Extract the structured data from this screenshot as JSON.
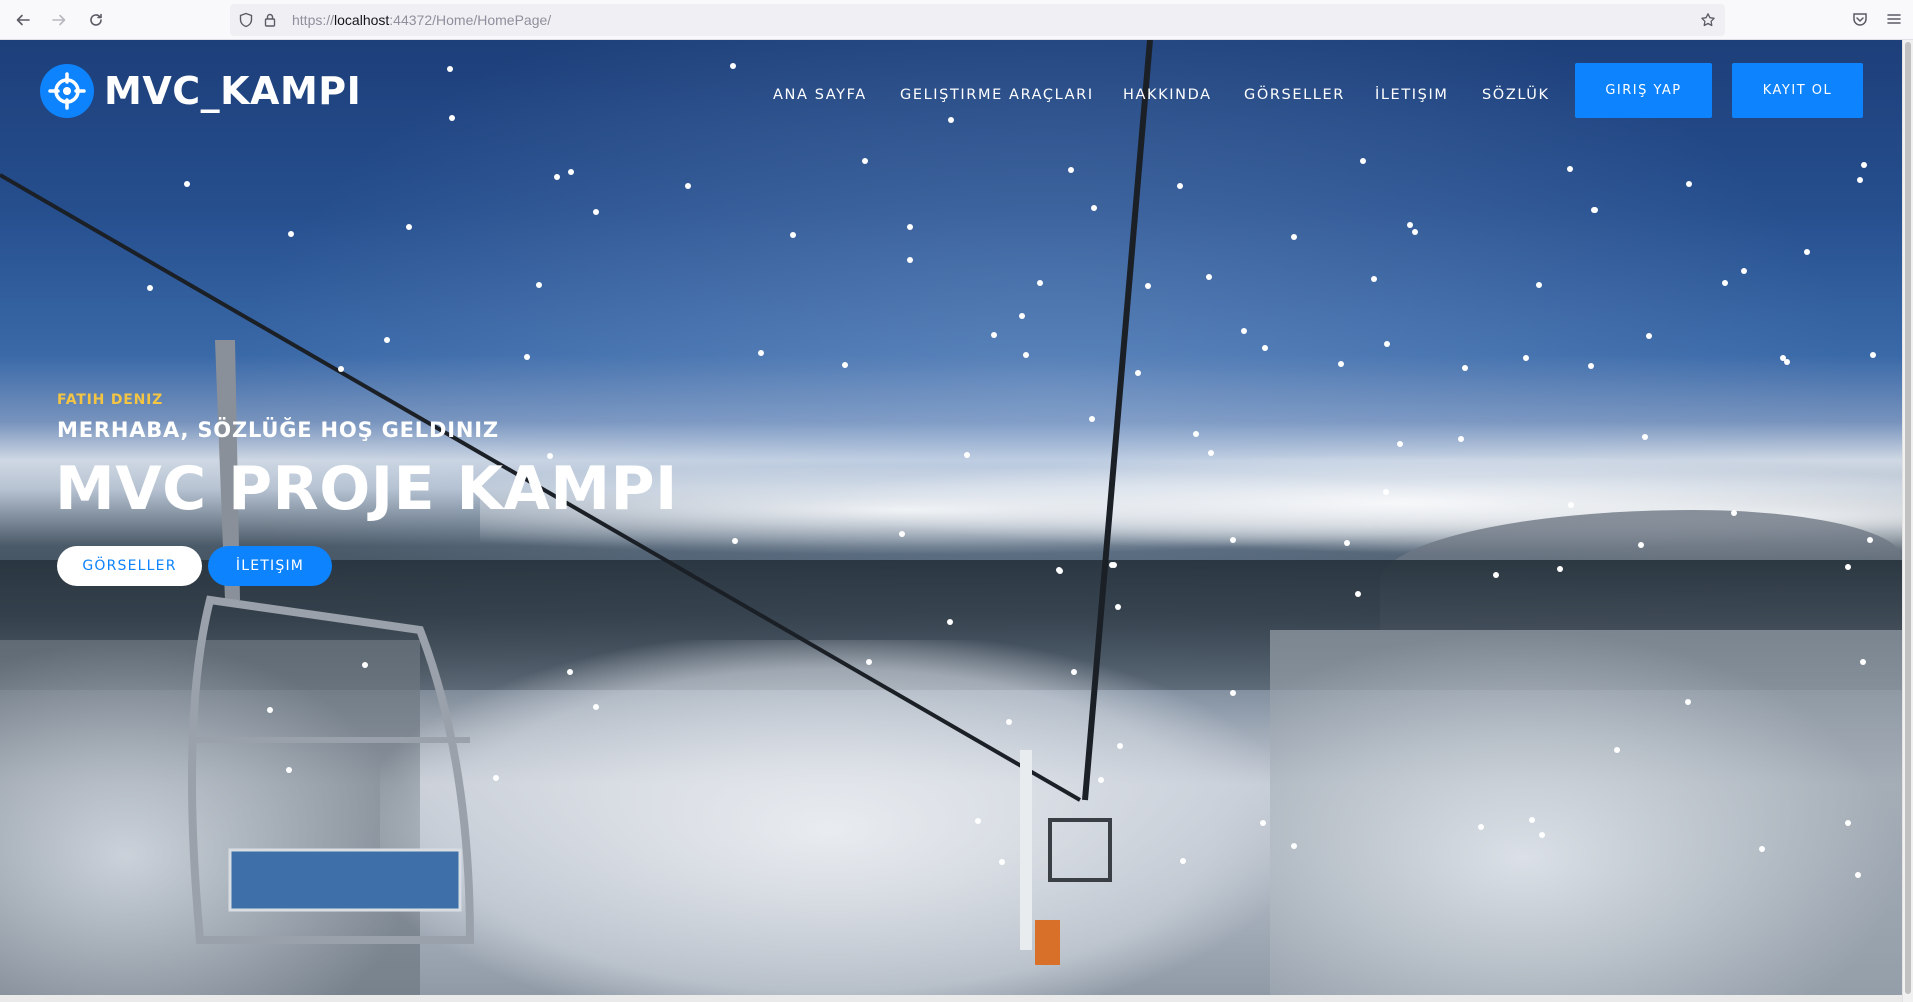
{
  "browser": {
    "url_prefix": "https://",
    "url_host": "localhost",
    "url_rest": ":44372/Home/HomePage/"
  },
  "icons": {
    "back": "arrow-left-icon",
    "forward": "arrow-right-icon",
    "reload": "reload-icon",
    "shield": "shield-icon",
    "lock": "lock-icon",
    "bookmark": "star-icon",
    "pocket": "pocket-icon",
    "menu": "hamburger-menu-icon",
    "logo": "crosshair-icon"
  },
  "site": {
    "logo_text": "MVC_KAMPI",
    "nav": [
      {
        "label": "ANA SAYFA"
      },
      {
        "label": "GELIŞTIRME ARAÇLARI"
      },
      {
        "label": "HAKKINDA"
      },
      {
        "label": "GÖRSELLER"
      },
      {
        "label": "İLETIŞIM"
      },
      {
        "label": "SÖZLÜK"
      }
    ],
    "login_label": "GIRIŞ YAP",
    "register_label": "KAYIT OL"
  },
  "hero": {
    "kicker": "FATIH DENIZ",
    "subtitle": "MERHABA, SÖZLÜĞE HOŞ GELDINIZ",
    "headline": "MVC PROJE KAMPI",
    "button_gallery": "GÖRSELLER",
    "button_contact": "İLETIŞIM"
  },
  "colors": {
    "accent": "#0d83fd",
    "kicker": "#f4c542",
    "text": "#ffffff"
  }
}
